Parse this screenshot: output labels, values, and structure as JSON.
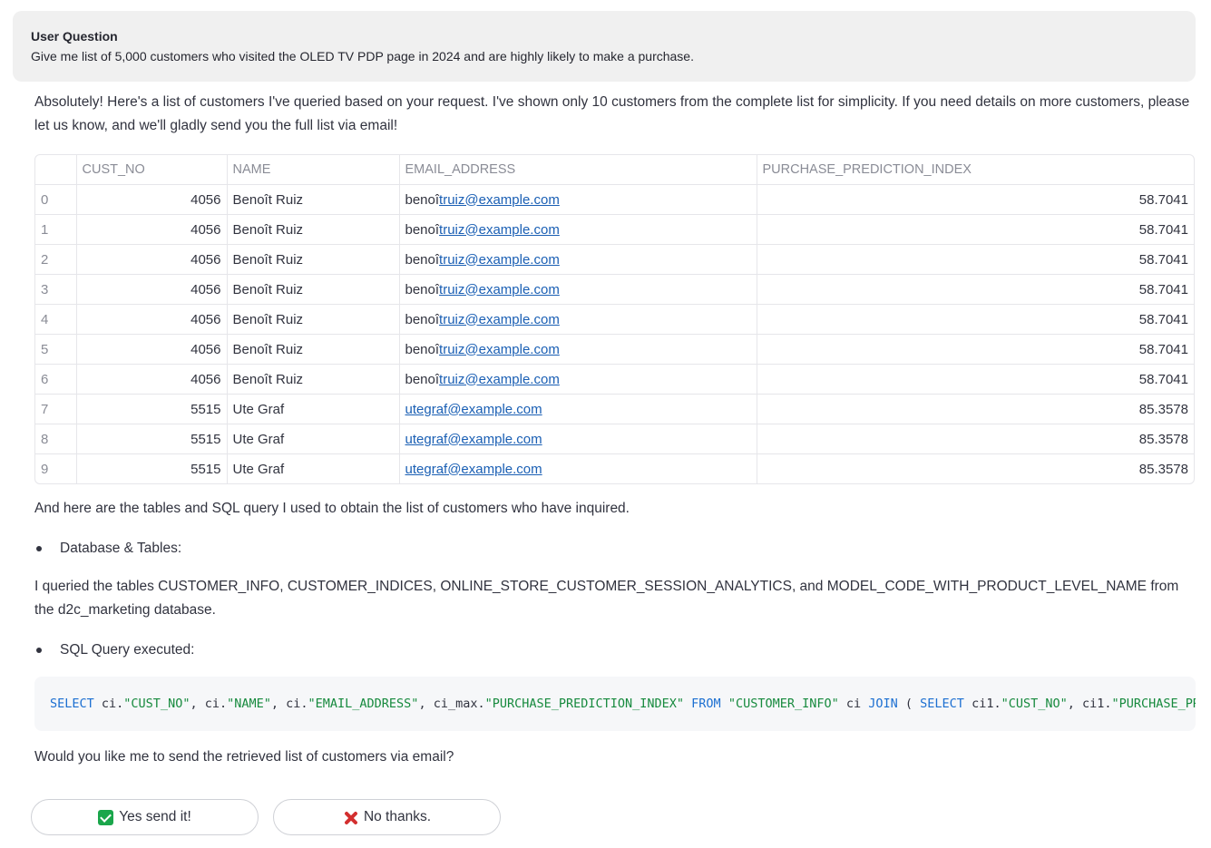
{
  "question": {
    "title": "User Question",
    "text": "Give me list of 5,000 customers who visited the OLED TV PDP page in 2024 and are highly likely to make a purchase."
  },
  "answer": {
    "intro": "Absolutely! Here's a list of customers I've queried based on your request. I've shown only 10 customers from the complete list for simplicity. If you need details on more customers, please let us know, and we'll gladly send you the full list via email!",
    "tables_intro": "And here are the tables and SQL query I used to obtain the list of customers who have inquired.",
    "bullet_db": "Database & Tables:",
    "db_text": "I queried the tables CUSTOMER_INFO, CUSTOMER_INDICES, ONLINE_STORE_CUSTOMER_SESSION_ANALYTICS, and MODEL_CODE_WITH_PRODUCT_LEVEL_NAME from the d2c_marketing database.",
    "bullet_sql": "SQL Query executed:",
    "closing": "Would you like me to send the retrieved list of customers via email?"
  },
  "table": {
    "columns": [
      "",
      "CUST_NO",
      "NAME",
      "EMAIL_ADDRESS",
      "PURCHASE_PREDICTION_INDEX"
    ],
    "rows": [
      {
        "idx": "0",
        "cust_no": "4056",
        "name": "Benoît Ruiz",
        "email_prefix": "benoî",
        "email_link": "truiz@example.com",
        "ppi": "58.7041"
      },
      {
        "idx": "1",
        "cust_no": "4056",
        "name": "Benoît Ruiz",
        "email_prefix": "benoî",
        "email_link": "truiz@example.com",
        "ppi": "58.7041"
      },
      {
        "idx": "2",
        "cust_no": "4056",
        "name": "Benoît Ruiz",
        "email_prefix": "benoî",
        "email_link": "truiz@example.com",
        "ppi": "58.7041"
      },
      {
        "idx": "3",
        "cust_no": "4056",
        "name": "Benoît Ruiz",
        "email_prefix": "benoî",
        "email_link": "truiz@example.com",
        "ppi": "58.7041"
      },
      {
        "idx": "4",
        "cust_no": "4056",
        "name": "Benoît Ruiz",
        "email_prefix": "benoî",
        "email_link": "truiz@example.com",
        "ppi": "58.7041"
      },
      {
        "idx": "5",
        "cust_no": "4056",
        "name": "Benoît Ruiz",
        "email_prefix": "benoî",
        "email_link": "truiz@example.com",
        "ppi": "58.7041"
      },
      {
        "idx": "6",
        "cust_no": "4056",
        "name": "Benoît Ruiz",
        "email_prefix": "benoî",
        "email_link": "truiz@example.com",
        "ppi": "58.7041"
      },
      {
        "idx": "7",
        "cust_no": "5515",
        "name": "Ute Graf",
        "email_prefix": "",
        "email_link": "utegraf@example.com",
        "ppi": "85.3578"
      },
      {
        "idx": "8",
        "cust_no": "5515",
        "name": "Ute Graf",
        "email_prefix": "",
        "email_link": "utegraf@example.com",
        "ppi": "85.3578"
      },
      {
        "idx": "9",
        "cust_no": "5515",
        "name": "Ute Graf",
        "email_prefix": "",
        "email_link": "utegraf@example.com",
        "ppi": "85.3578"
      }
    ]
  },
  "sql": {
    "tokens": [
      {
        "t": "SELECT",
        "c": "kw"
      },
      {
        "t": " ci.",
        "c": ""
      },
      {
        "t": "\"CUST_NO\"",
        "c": "str"
      },
      {
        "t": ", ci.",
        "c": ""
      },
      {
        "t": "\"NAME\"",
        "c": "str"
      },
      {
        "t": ", ci.",
        "c": ""
      },
      {
        "t": "\"EMAIL_ADDRESS\"",
        "c": "str"
      },
      {
        "t": ", ci_max.",
        "c": ""
      },
      {
        "t": "\"PURCHASE_PREDICTION_INDEX\"",
        "c": "str"
      },
      {
        "t": " FROM ",
        "c": "kw"
      },
      {
        "t": "\"CUSTOMER_INFO\"",
        "c": "str"
      },
      {
        "t": " ci ",
        "c": ""
      },
      {
        "t": "JOIN",
        "c": "kw"
      },
      {
        "t": " ( ",
        "c": ""
      },
      {
        "t": "SELECT",
        "c": "kw"
      },
      {
        "t": " ci1.",
        "c": ""
      },
      {
        "t": "\"CUST_NO\"",
        "c": "str"
      },
      {
        "t": ", ci1.",
        "c": ""
      },
      {
        "t": "\"PURCHASE_PREDICTION_INDEX\"",
        "c": "str"
      }
    ]
  },
  "buttons": {
    "yes": "Yes send it!",
    "no": "No thanks."
  },
  "icons": {
    "yes": "check-mark-icon",
    "no": "cross-mark-icon"
  },
  "colors": {
    "link": "#1a5fb4",
    "keyword": "#1c6fd1",
    "string": "#178a3e",
    "check": "#1aa64b",
    "cross": "#d32f2f"
  }
}
